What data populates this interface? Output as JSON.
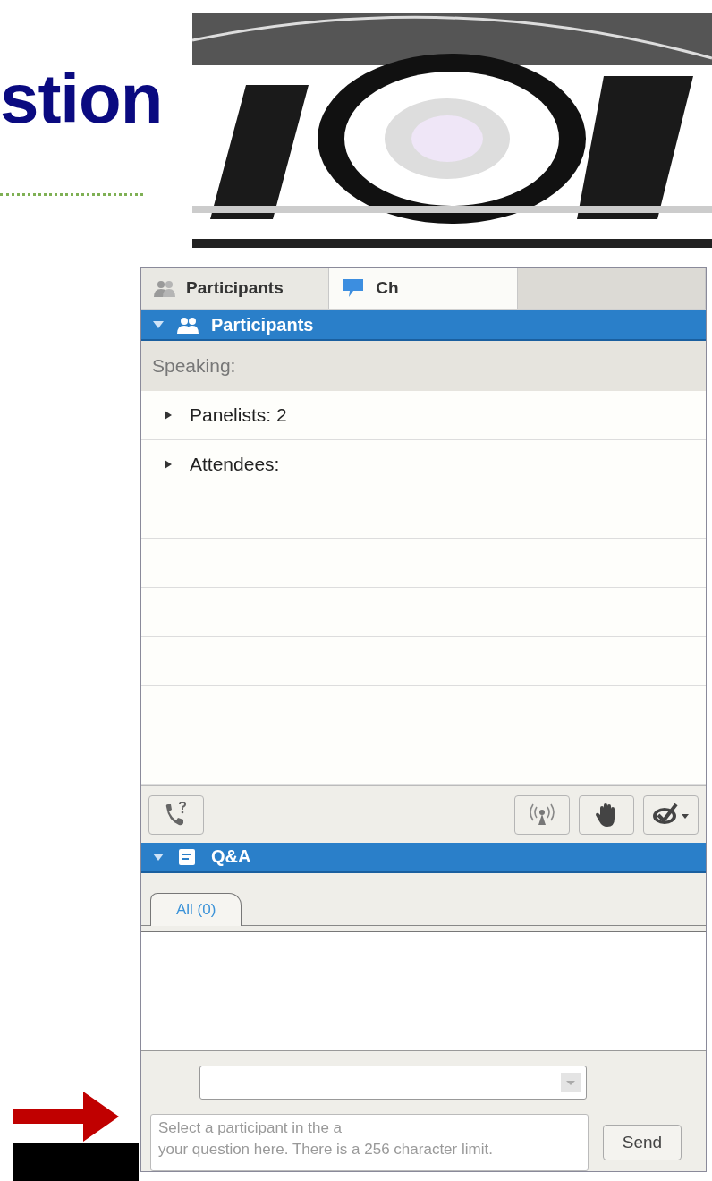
{
  "heading": "stion",
  "panel_tabs": [
    {
      "label": "Participants",
      "selected": true
    },
    {
      "label": "Ch",
      "selected": false
    },
    {
      "selected": false
    }
  ],
  "participants_section": {
    "title": "Participants",
    "expanded": true,
    "speaking_label": "Speaking:",
    "groups": [
      {
        "label": "Panelists: 2",
        "expanded": false
      },
      {
        "label": "Attendees:",
        "expanded": false
      }
    ]
  },
  "toolbar": {
    "left": [
      {
        "kind": "phone"
      }
    ],
    "right": [
      {
        "kind": "signal"
      },
      {
        "kind": "hand"
      },
      {
        "kind": "check"
      }
    ]
  },
  "qa_section": {
    "title": "Q&A",
    "expanded": true,
    "tabs": [
      {
        "label": "All (0)",
        "selected": true
      }
    ],
    "question_field": {
      "placeholder": "Select a participant in the a\nyour question here. There is a 256 character limit."
    },
    "send_button": "Send"
  }
}
